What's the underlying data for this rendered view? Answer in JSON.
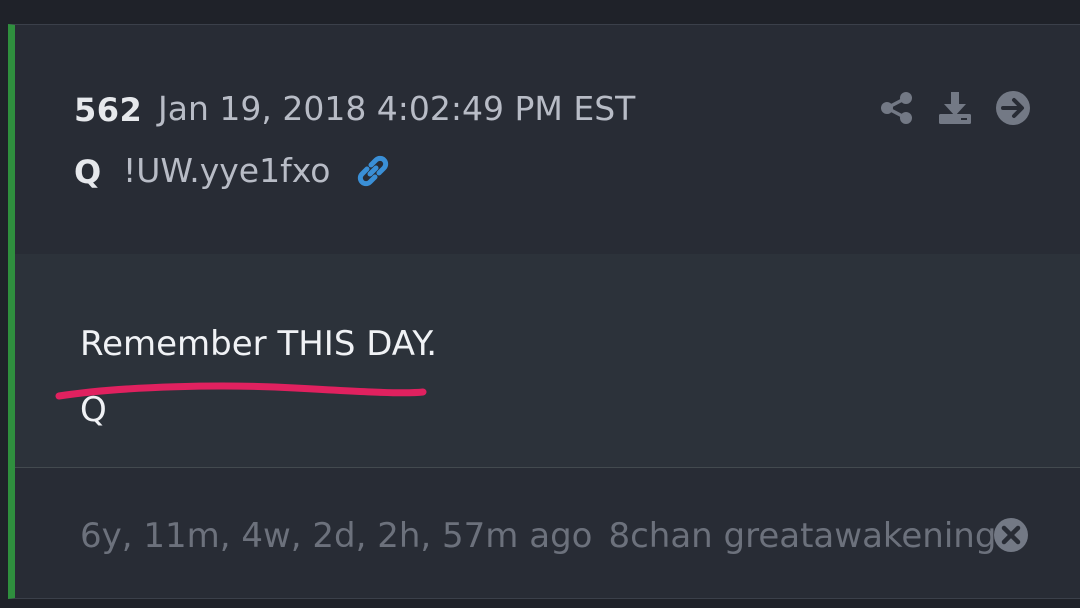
{
  "post": {
    "number": "562",
    "date": "Jan 19, 2018 4:02:49 PM EST",
    "author": "Q",
    "tripcode": "!UW.yye1fxo",
    "body": {
      "line1": "Remember THIS DAY.",
      "line2": "Q"
    },
    "footer": {
      "age": "6y, 11m, 4w, 2d, 2h, 57m ago",
      "source": "8chan greatawakening"
    }
  },
  "icons": {
    "header": [
      "share-icon",
      "download-icon",
      "arrow-right-icon"
    ],
    "inline": "link-icon",
    "footer": "close-icon"
  },
  "colors": {
    "accent_border": "#2f8f3e",
    "link_icon": "#3a8fd6",
    "annotation": "#e0215f"
  }
}
